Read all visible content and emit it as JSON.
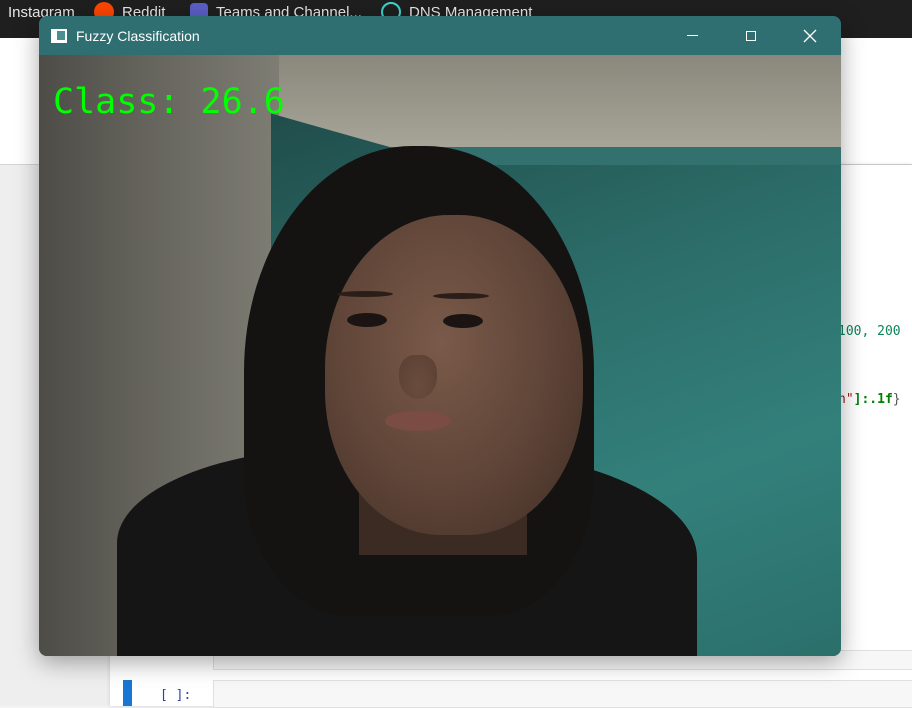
{
  "bookmarks": [
    {
      "label": "Instagram",
      "icon": "instagram-icon"
    },
    {
      "label": "Reddit",
      "icon": "reddit-icon"
    },
    {
      "label": "Teams and Channel...",
      "icon": "teams-icon"
    },
    {
      "label": "DNS Management",
      "icon": "dns-icon"
    }
  ],
  "notebook": {
    "code_fragment_1": "100, 200",
    "code_fragment_2_str": "h\"",
    "code_fragment_2_fmt": "]:.1f",
    "code_fragment_2_brace": "}",
    "cell_prompt": "[ ]:"
  },
  "window": {
    "title": "Fuzzy Classification",
    "titlebar_color": "#2f6e71"
  },
  "overlay": {
    "class_text": "Class: 26.6",
    "text_color": "#00ff00"
  }
}
